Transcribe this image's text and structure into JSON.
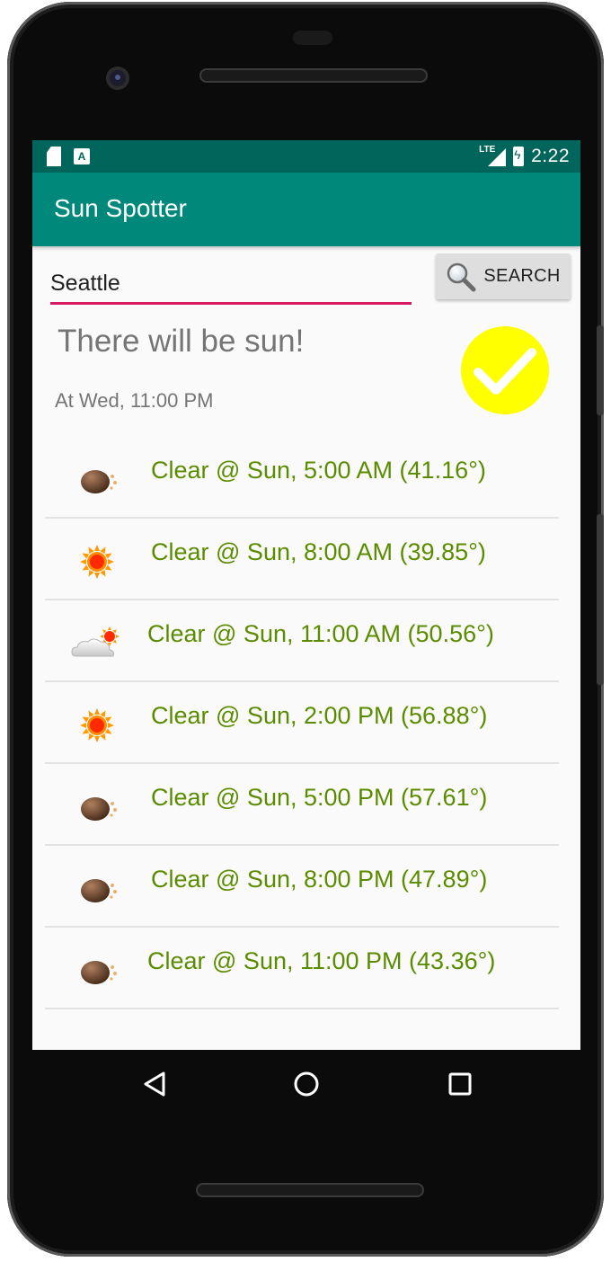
{
  "status_bar": {
    "time": "2:22",
    "network": "LTE",
    "notif_a": "A"
  },
  "app_bar": {
    "title": "Sun Spotter"
  },
  "search": {
    "value": "Seattle",
    "button_label": "SEARCH"
  },
  "result": {
    "headline": "There will be sun!",
    "subline": "At Wed, 11:00 PM"
  },
  "forecast": [
    {
      "text": "Clear @ Sun, 5:00 AM (41.16°)",
      "icon": "night-moon-icon"
    },
    {
      "text": "Clear @ Sun, 8:00 AM (39.85°)",
      "icon": "sun-icon"
    },
    {
      "text": "Clear @ Sun, 11:00 AM (50.56°)",
      "icon": "partly-cloudy-icon"
    },
    {
      "text": "Clear @ Sun, 2:00 PM (56.88°)",
      "icon": "sun-icon"
    },
    {
      "text": "Clear @ Sun, 5:00 PM (57.61°)",
      "icon": "night-moon-icon"
    },
    {
      "text": "Clear @ Sun, 8:00 PM (47.89°)",
      "icon": "night-moon-icon"
    },
    {
      "text": "Clear @ Sun, 11:00 PM (43.36°)",
      "icon": "night-moon-icon"
    }
  ],
  "colors": {
    "app_bar": "#00897b",
    "status_bar": "#00665b",
    "accent_underline": "#d81b60",
    "forecast_text": "#5b8c00",
    "check_badge": "#ffff00"
  }
}
